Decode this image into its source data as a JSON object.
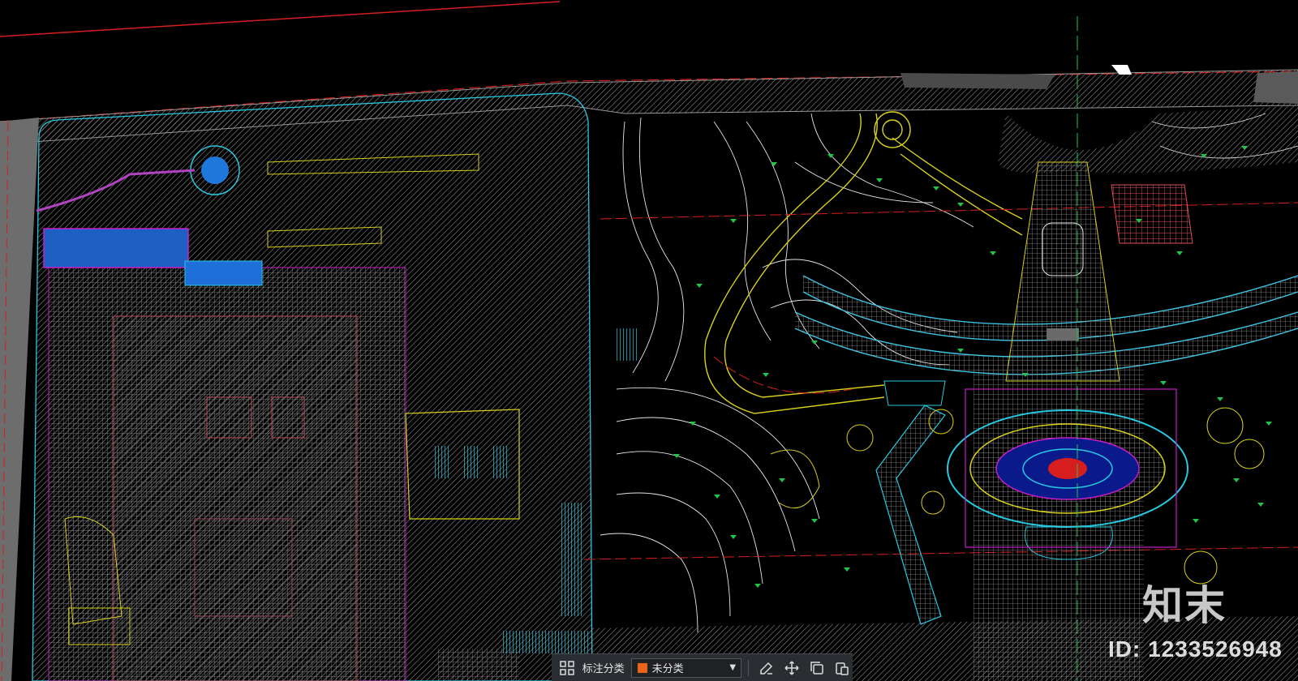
{
  "toolbar": {
    "annotation_label": "标注分类",
    "category_value": "未分类",
    "category_color": "#e8641a",
    "icons": [
      "grid-icon",
      "edit-icon",
      "move-icon",
      "copy-icon",
      "paste-icon"
    ]
  },
  "watermark": {
    "logo_text": "知末",
    "id_text": "ID: 1233526948"
  },
  "colors": {
    "background": "#000000",
    "hatch_gray": "#7a7a7a",
    "contour": "#ffffff",
    "road_yellow": "#d9d01a",
    "cyan": "#27c9e0",
    "red_line": "#d61e1e",
    "magenta": "#c81ec8",
    "green_marker": "#21c44a",
    "blue_fill": "#1e6fd9"
  }
}
